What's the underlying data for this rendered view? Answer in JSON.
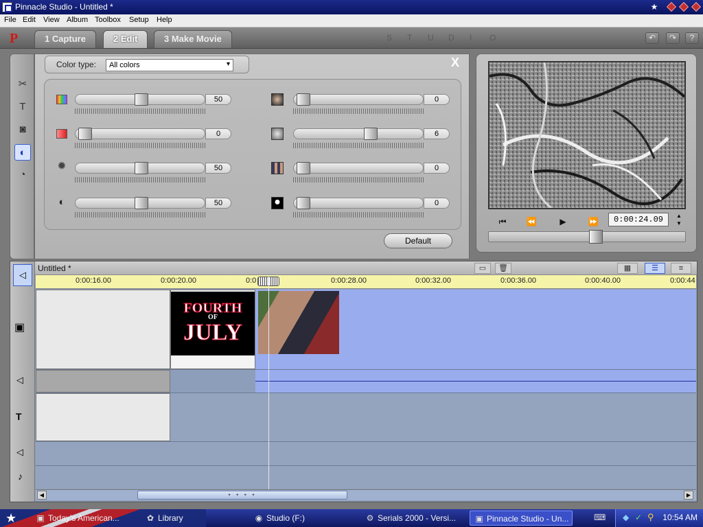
{
  "window": {
    "title": "Pinnacle Studio - Untitled *",
    "controls": [
      "★",
      "◆",
      "◆",
      "◆"
    ]
  },
  "menubar": {
    "items": [
      "File",
      "Edit",
      "View",
      "Album",
      "Toolbox",
      "Setup",
      "Help"
    ]
  },
  "modebar": {
    "logo": "P",
    "tabs": [
      {
        "label": "1 Capture",
        "active": false
      },
      {
        "label": "2 Edit",
        "active": true
      },
      {
        "label": "3 Make Movie",
        "active": false
      }
    ],
    "studio_letters": [
      "S",
      "T",
      "U",
      "D",
      "I",
      "O"
    ],
    "undo_icon": "undo-icon",
    "redo_icon": "redo-icon",
    "help_label": "?"
  },
  "toolbox": {
    "icons": [
      "video-toolbox-icon",
      "title-toolbox-icon",
      "camera-toolbox-icon",
      "effects-toolbox-icon",
      "speed-toolbox-icon"
    ],
    "active_index": 3
  },
  "effect_panel": {
    "color_type_label": "Color type:",
    "color_type_value": "All colors",
    "close_label": "X",
    "left_sliders": [
      {
        "icon": "hue-icon",
        "value": "50",
        "level": 0.5
      },
      {
        "icon": "saturation-icon",
        "value": "0",
        "level": 0.0
      },
      {
        "icon": "brightness-icon",
        "value": "50",
        "level": 0.5
      },
      {
        "icon": "contrast-icon",
        "value": "50",
        "level": 0.5
      }
    ],
    "right_sliders": [
      {
        "icon": "blur-icon",
        "value": "0",
        "level": 0.0
      },
      {
        "icon": "emboss-icon",
        "value": "6",
        "level": 0.6
      },
      {
        "icon": "mosaic-icon",
        "value": "0",
        "level": 0.0
      },
      {
        "icon": "posterize-icon",
        "value": "0",
        "level": 0.0
      }
    ],
    "default_label": "Default"
  },
  "player": {
    "controls": [
      "⏮",
      "⏪",
      "▶",
      "⏩"
    ],
    "timecode": "0:00:24.09",
    "scrub_level": 0.55
  },
  "timeline": {
    "title": "Untitled *",
    "ruler_labels": [
      "0:00:16.00",
      "0:00:20.00",
      "0:0",
      "0:00:28.00",
      "0:00:32.00",
      "0:00:36.00",
      "0:00:40.00",
      "0:00:44"
    ],
    "clip_title_text": [
      "FOURTH",
      "OF",
      "JULY"
    ],
    "track_icons": [
      "video-track-icon",
      "audio-track-icon",
      "title-track-icon",
      "sound-effect-track-icon",
      "music-track-icon"
    ],
    "header_icons": [
      "storyboard-view-icon",
      "delete-icon",
      "scene-view-icon",
      "timeline-view-icon",
      "text-view-icon"
    ]
  },
  "taskbar": {
    "start_icon": "start-star-icon",
    "tasks": [
      {
        "label": "Today's American...",
        "active": false
      },
      {
        "label": "Library",
        "active": false
      },
      {
        "label": "Studio (F:)",
        "active": false
      },
      {
        "label": "Serials 2000 - Versi...",
        "active": false
      },
      {
        "label": "Pinnacle Studio - Un...",
        "active": true
      }
    ],
    "clock": "10:54 AM"
  },
  "colors": {
    "title_blue": "#0a1460",
    "timeline_blue": "#99acee",
    "ruler_yellow": "#f6f4a8",
    "logo_red": "#d21818"
  }
}
